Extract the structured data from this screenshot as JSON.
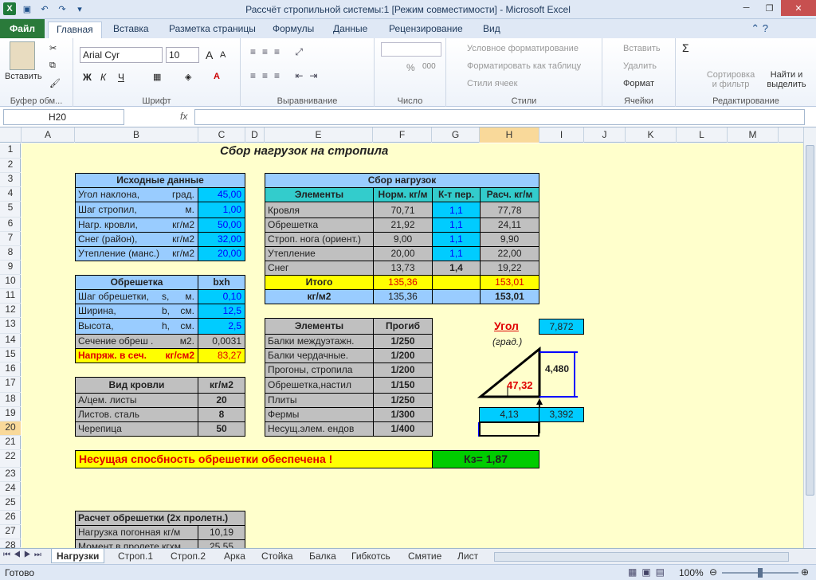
{
  "window": {
    "title": "Рассчёт стропильной системы:1  [Режим совместимости]  -  Microsoft Excel"
  },
  "tabs": [
    "Файл",
    "Главная",
    "Вставка",
    "Разметка страницы",
    "Формулы",
    "Данные",
    "Рецензирование",
    "Вид"
  ],
  "ribbon": {
    "paste": "Вставить",
    "clipboard": "Буфер обм...",
    "font_name": "Arial Cyr",
    "font_size": "10",
    "font": "Шрифт",
    "align": "Выравнивание",
    "number": "Число",
    "cond_format": "Условное форматирование",
    "format_table": "Форматировать как таблицу",
    "cell_styles": "Стили ячеек",
    "styles": "Стили",
    "insert": "Вставить",
    "delete": "Удалить",
    "format": "Формат",
    "cells": "Ячейки",
    "sort": "Сортировка и фильтр",
    "find": "Найти и выделить",
    "edit": "Редактирование",
    "bold": "Ж",
    "italic": "К",
    "underline": "Ч",
    "grow_font": "A",
    "shrink_font": "A",
    "percent": "%",
    "thousands": "000"
  },
  "formula_bar": {
    "name_box": "H20",
    "fx": "fx"
  },
  "columns": [
    "A",
    "B",
    "C",
    "D",
    "E",
    "F",
    "G",
    "H",
    "I",
    "J",
    "K",
    "L",
    "M"
  ],
  "rows": [
    "1",
    "2",
    "3",
    "4",
    "5",
    "6",
    "7",
    "8",
    "9",
    "10",
    "11",
    "12",
    "13",
    "14",
    "15",
    "16",
    "17",
    "18",
    "19",
    "20",
    "21",
    "22",
    "23",
    "24",
    "25",
    "26",
    "27",
    "28"
  ],
  "sheet": {
    "title": "Сбор нагрузок на стропила",
    "initial": {
      "header": "Исходные данные",
      "rows": [
        {
          "l": "Угол наклона,",
          "u": "град.",
          "v": "45,00"
        },
        {
          "l": "Шаг стропил,",
          "u": "м.",
          "v": "1,00"
        },
        {
          "l": "Нагр. кровли,",
          "u": "кг/м2",
          "v": "50,00"
        },
        {
          "l": "Снег (район),",
          "u": "кг/м2",
          "v": "32,00"
        },
        {
          "l": "Утепление (манс.)",
          "u": "кг/м2",
          "v": "20,00"
        }
      ]
    },
    "lath": {
      "header": "Обрешетка",
      "header2": "bxh",
      "rows": [
        {
          "l": "Шаг обрешетки,",
          "s": "s,",
          "u": "м.",
          "v": "0,10"
        },
        {
          "l": "Ширина,",
          "s": "b,",
          "u": "см.",
          "v": "12,5"
        },
        {
          "l": "Высота,",
          "s": "h,",
          "u": "см.",
          "v": "2,5"
        },
        {
          "l": "Сечение обреш .",
          "s": "",
          "u": "м2.",
          "v": "0,0031"
        },
        {
          "l": "Напряж. в сеч.",
          "s": "",
          "u": "кг/см2",
          "v": "83,27"
        }
      ]
    },
    "roof": {
      "header": "Вид кровли",
      "header2": "кг/м2",
      "rows": [
        {
          "l": "А/цем. листы",
          "v": "20"
        },
        {
          "l": "Листов. сталь",
          "v": "8"
        },
        {
          "l": "Черепица",
          "v": "50"
        }
      ]
    },
    "loads": {
      "header": "Сбор нагрузок",
      "cols": [
        "Элементы",
        "Норм. кг/м",
        "К-т пер.",
        "Расч. кг/м"
      ],
      "rows": [
        [
          "Кровля",
          "70,71",
          "1,1",
          "77,78"
        ],
        [
          "Обрешетка",
          "21,92",
          "1,1",
          "24,11"
        ],
        [
          "Строп. нога (ориент.)",
          "9,00",
          "1,1",
          "9,90"
        ],
        [
          "Утепление",
          "20,00",
          "1,1",
          "22,00"
        ],
        [
          "Снег",
          "13,73",
          "1,4",
          "19,22"
        ]
      ],
      "total": [
        "Итого",
        "135,36",
        "",
        "153,01"
      ],
      "per": [
        "кг/м2",
        "135,36",
        "",
        "153,01"
      ]
    },
    "deflection": {
      "cols": [
        "Элементы",
        "Прогиб"
      ],
      "rows": [
        [
          "Балки междуэтажн.",
          "1/250"
        ],
        [
          "Балки чердачные.",
          "1/200"
        ],
        [
          "Прогоны, стропила",
          "1/200"
        ],
        [
          "Обрешетка,настил",
          "1/150"
        ],
        [
          "Плиты",
          "1/250"
        ],
        [
          "Фермы",
          "1/300"
        ],
        [
          "Несущ.элем. ендов",
          "1/400"
        ]
      ]
    },
    "angle": {
      "label": "Угол",
      "unit": "(град.)",
      "value": "7,872",
      "height": "4,480",
      "inner": "47,32",
      "base": "4,13",
      "right": "3,392"
    },
    "result": {
      "text": "Несущая спосбность обрешетки   обеспечена !",
      "k": "Кз=  1,87"
    },
    "calc": {
      "header": "Расчет обрешетки (2х пролетн.)",
      "rows": [
        {
          "l": "Нагрузка погонная кг/м",
          "v": "10,19"
        },
        {
          "l": "Момент в пролете  кгхм",
          "v": "25,55"
        }
      ]
    }
  },
  "sheet_tabs": [
    "Нагрузки",
    "Строп.1",
    "Строп.2",
    "Арка",
    "Стойка",
    "Балка",
    "Гибкотсь",
    "Смятие",
    "Лист"
  ],
  "status": {
    "ready": "Готово",
    "zoom": "100%"
  }
}
